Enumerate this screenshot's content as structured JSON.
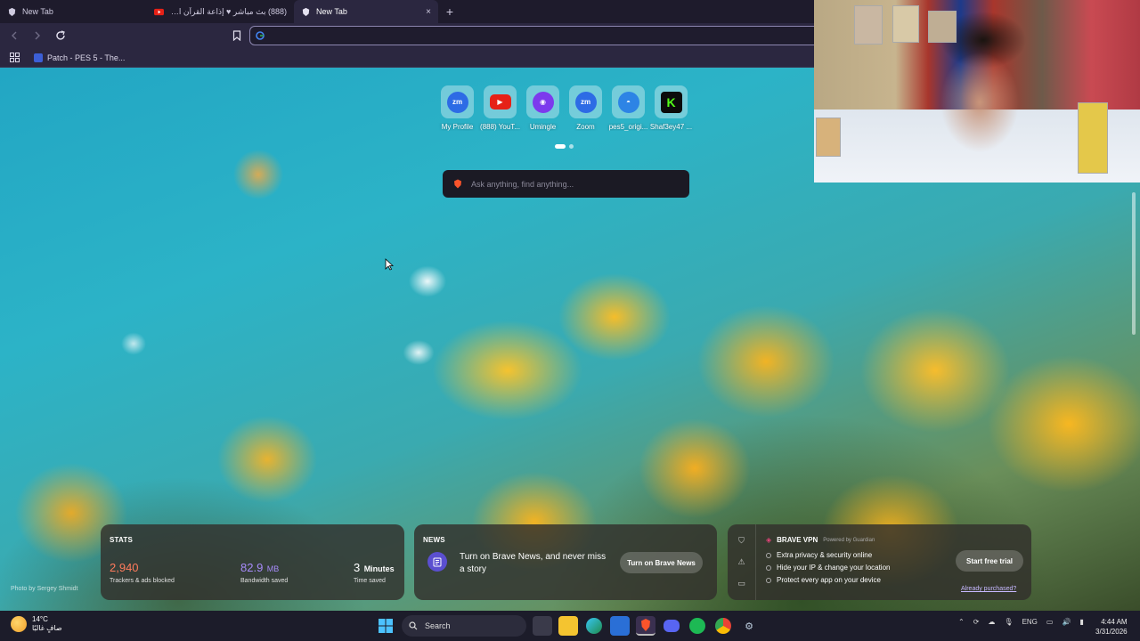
{
  "tabs": [
    {
      "title": "New Tab",
      "icon": "brave-icon"
    },
    {
      "title": "(888) بث مباشر ♥ إذاعة القرآن الكريم ...",
      "icon": "youtube-icon"
    },
    {
      "title": "New Tab",
      "icon": "brave-icon",
      "active": true,
      "close": "×"
    }
  ],
  "newtab_button": "+",
  "omnibox": {
    "value": "",
    "icon": "google-icon"
  },
  "bookmarks": [
    {
      "label": "Patch - PES 5 - The..."
    }
  ],
  "top_sites": [
    {
      "label": "My Profile",
      "glyph": "zm",
      "color": "#2d6be5"
    },
    {
      "label": "(888) YouT...",
      "glyph": "▶",
      "color": "#e62117"
    },
    {
      "label": "Umingle",
      "glyph": "◉",
      "color": "#7c3aed"
    },
    {
      "label": "Zoom",
      "glyph": "zm",
      "color": "#2d6be5"
    },
    {
      "label": "pes5_origi...",
      "glyph": "◓",
      "color": "#2d84e5"
    },
    {
      "label": "Shaf3ey47 ...",
      "glyph": "K",
      "color": "#53fc18"
    }
  ],
  "search": {
    "placeholder": "Ask anything, find anything..."
  },
  "stats": {
    "heading": "STATS",
    "trackers": {
      "value": "2,940",
      "label": "Trackers & ads blocked",
      "color": "#ff7b5c"
    },
    "bandwidth": {
      "value": "82.9",
      "unit": "MB",
      "label": "Bandwidth saved",
      "color": "#a78bfa"
    },
    "time": {
      "value": "3",
      "unit": "Minutes",
      "label": "Time saved"
    }
  },
  "news": {
    "heading": "NEWS",
    "text": "Turn on Brave News, and never miss a story",
    "button": "Turn on Brave News"
  },
  "vpn": {
    "heading": "BRAVE VPN",
    "powered": "Powered by Guardian",
    "features": [
      "Extra privacy & security online",
      "Hide your IP & change your location",
      "Protect every app on your device"
    ],
    "button": "Start free trial",
    "link": "Already purchased?"
  },
  "photo_credit": "Photo by Sergey Shmidt",
  "taskbar": {
    "weather_temp": "14°C",
    "weather_desc": "صافٍ غالبًا",
    "search_label": "Search",
    "language": "ENG",
    "time": "4:44 AM",
    "date": "3/31/2026"
  }
}
